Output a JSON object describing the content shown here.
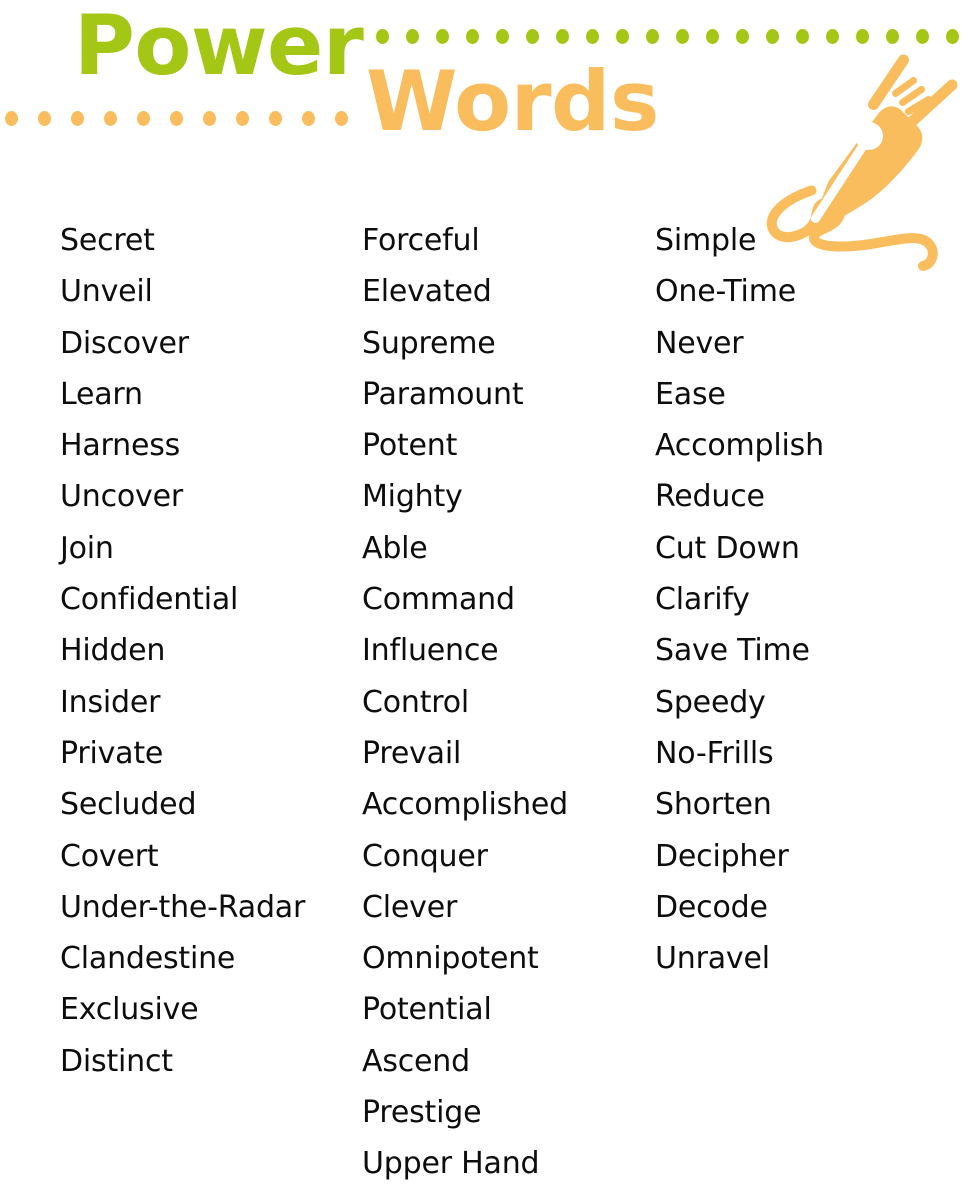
{
  "header": {
    "title_part_1": "Power",
    "title_part_2": "Words",
    "title_colors": {
      "power_green": "#a3c714",
      "words_orange": "#fabd5e"
    },
    "decorations": {
      "green_dot_row_count": 23,
      "orange_dot_row_count": 11,
      "pen_icon": "fountain-pen-nib-icon",
      "pen_color": "#fabd5e"
    }
  },
  "list": {
    "text_color": "#0d0d0d",
    "columns": [
      {
        "id": "column-1",
        "words": [
          "Secret",
          "Unveil",
          "Discover",
          "Learn",
          "Harness",
          "Uncover",
          "Join",
          "Confidential",
          "Hidden",
          "Insider",
          "Private",
          "Secluded",
          "Covert",
          "Under-the-Radar",
          "Clandestine",
          "Exclusive",
          "Distinct"
        ]
      },
      {
        "id": "column-2",
        "words": [
          "Forceful",
          "Elevated",
          "Supreme",
          "Paramount",
          "Potent",
          "Mighty",
          "Able",
          "Command",
          "Influence",
          "Control",
          "Prevail",
          "Accomplished",
          "Conquer",
          "Clever",
          "Omnipotent",
          "Potential",
          "Ascend",
          "Prestige",
          "Upper Hand"
        ]
      },
      {
        "id": "column-3",
        "words": [
          "Simple",
          "One-Time",
          "Never",
          "Ease",
          "Accomplish",
          "Reduce",
          "Cut Down",
          "Clarify",
          "Save Time",
          "Speedy",
          "No-Frills",
          "Shorten",
          "Decipher",
          "Decode",
          "Unravel"
        ]
      }
    ]
  }
}
